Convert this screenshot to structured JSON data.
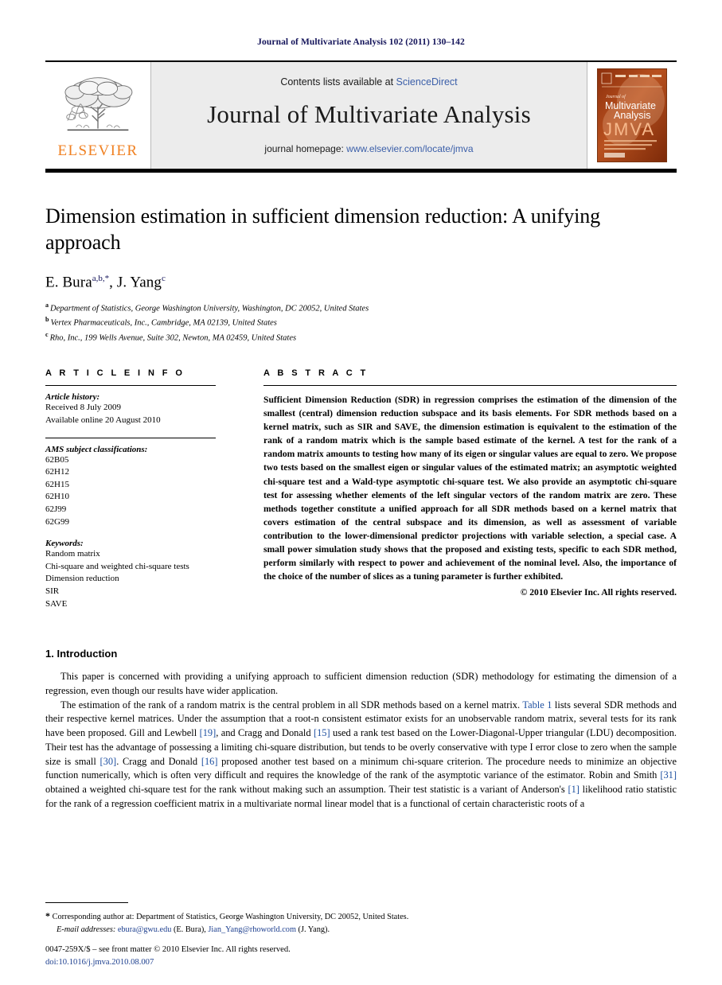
{
  "running_head": "Journal of Multivariate Analysis 102 (2011) 130–142",
  "masthead": {
    "contents_prefix": "Contents lists available at ",
    "sciencedirect": "ScienceDirect",
    "journal_name": "Journal of Multivariate Analysis",
    "homepage_prefix": "journal homepage: ",
    "homepage_url": "www.elsevier.com/locate/jmva",
    "publisher_wordmark": "ELSEVIER",
    "cover_alt": "Journal of Multivariate Analysis JMVA cover",
    "cover_title_small": "Journal of",
    "cover_title_line1": "Multivariate",
    "cover_title_line2": "Analysis",
    "cover_acronym": "JMVA",
    "accent_orange": "#f08122",
    "link_blue": "#3b5fa9",
    "cover_bg": "#a33c12"
  },
  "title": "Dimension estimation in sufficient dimension reduction: A unifying approach",
  "authors": {
    "author1_name": "E. Bura",
    "author1_marks": "a,b,*",
    "separator": ", ",
    "author2_name": "J. Yang",
    "author2_marks": "c"
  },
  "affiliations": [
    {
      "mark": "a",
      "text": "Department of Statistics, George Washington University, Washington, DC 20052, United States"
    },
    {
      "mark": "b",
      "text": "Vertex Pharmaceuticals, Inc., Cambridge, MA 02139, United States"
    },
    {
      "mark": "c",
      "text": "Rho, Inc., 199 Wells Avenue, Suite 302, Newton, MA 02459, United States"
    }
  ],
  "article_info": {
    "heading": "A R T I C L E    I N F O",
    "history_label": "Article history:",
    "history_lines": [
      "Received 8 July 2009",
      "Available online 20 August 2010"
    ],
    "ams_label": "AMS subject classifications:",
    "ams_codes": [
      "62B05",
      "62H12",
      "62H15",
      "62H10",
      "62J99",
      "62G99"
    ],
    "keywords_label": "Keywords:",
    "keywords": [
      "Random matrix",
      "Chi-square and weighted chi-square tests",
      "Dimension reduction",
      "SIR",
      "SAVE"
    ]
  },
  "abstract": {
    "heading": "A B S T R A C T",
    "text": "Sufficient Dimension Reduction (SDR) in regression comprises the estimation of the dimension of the smallest (central) dimension reduction subspace and its basis elements. For SDR methods based on a kernel matrix, such as SIR and SAVE, the dimension estimation is equivalent to the estimation of the rank of a random matrix which is the sample based estimate of the kernel. A test for the rank of a random matrix amounts to testing how many of its eigen or singular values are equal to zero. We propose two tests based on the smallest eigen or singular values of the estimated matrix; an asymptotic weighted chi-square test and a Wald-type asymptotic chi-square test. We also provide an asymptotic chi-square test for assessing whether elements of the left singular vectors of the random matrix are zero. These methods together constitute a unified approach for all SDR methods based on a kernel matrix that covers estimation of the central subspace and its dimension, as well as assessment of variable contribution to the lower-dimensional predictor projections with variable selection, a special case. A small power simulation study shows that the proposed and existing tests, specific to each SDR method, perform similarly with respect to power and achievement of the nominal level. Also, the importance of the choice of the number of slices as a tuning parameter is further exhibited.",
    "copyright": "© 2010 Elsevier Inc. All rights reserved."
  },
  "section1": {
    "title": "1.  Introduction",
    "para1": "This paper is concerned with providing a unifying approach to sufficient dimension reduction (SDR) methodology for estimating the dimension of a regression, even though our results have wider application.",
    "para2_a": "The estimation of the rank of a random matrix is the central problem in all SDR methods based on a kernel matrix. ",
    "para2_table_ref": "Table 1",
    "para2_b": " lists several SDR methods and their respective kernel matrices. Under the assumption that a root-n consistent estimator exists for an unobservable random matrix, several tests for its rank have been proposed. Gill and Lewbell ",
    "ref19": "[19]",
    "para2_c": ", and Cragg and Donald ",
    "ref15": "[15]",
    "para2_d": " used a rank test based on the Lower-Diagonal-Upper triangular (LDU) decomposition. Their test has the advantage of possessing a limiting chi-square distribution, but tends to be overly conservative with type I error close to zero when the sample size is small ",
    "ref30": "[30]",
    "para2_e": ". Cragg and Donald ",
    "ref16": "[16]",
    "para2_f": " proposed another test based on a minimum chi-square criterion. The procedure needs to minimize an objective function numerically, which is often very difficult and requires the knowledge of the rank of the asymptotic variance of the estimator. Robin and Smith ",
    "ref31": "[31]",
    "para2_g": " obtained a weighted chi-square test for the rank without making such an assumption. Their test statistic is a variant of Anderson's ",
    "ref1": "[1]",
    "para2_h": " likelihood ratio statistic for the rank of a regression coefficient matrix in a multivariate normal linear model that is a functional of certain characteristic roots of a"
  },
  "footnote": {
    "star": "*",
    "corresponding": "Corresponding author at: Department of Statistics, George Washington University, DC 20052, United States.",
    "email_label": "E-mail addresses:",
    "email1": "ebura@gwu.edu",
    "email1_who": " (E. Bura),",
    "email2": "Jian_Yang@rhoworld.com",
    "email2_who": " (J. Yang)."
  },
  "imprint": {
    "line1": "0047-259X/$ – see front matter © 2010 Elsevier Inc. All rights reserved.",
    "doi": "doi:10.1016/j.jmva.2010.08.007"
  }
}
